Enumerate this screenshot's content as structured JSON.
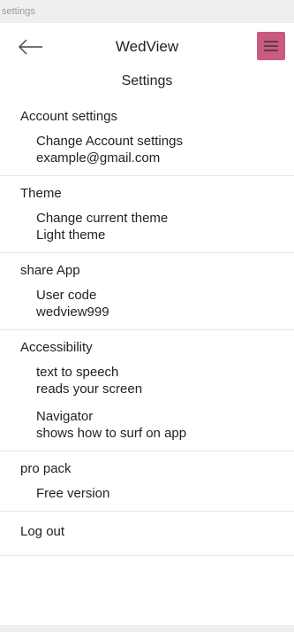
{
  "statusbar": {
    "text": "settings"
  },
  "appbar": {
    "title": "WedView",
    "back_icon": "arrow-left-icon",
    "menu_icon": "hamburger-menu-icon",
    "accent": "#c95a80"
  },
  "page": {
    "title": "Settings"
  },
  "sections": [
    {
      "title": "Account settings",
      "items": [
        {
          "label": "Change Account settings",
          "value": "example@gmail.com"
        }
      ]
    },
    {
      "title": "Theme",
      "items": [
        {
          "label": "Change current theme",
          "value": "Light theme"
        }
      ]
    },
    {
      "title": "share App",
      "items": [
        {
          "label": "User code",
          "value": "wedview999"
        }
      ]
    },
    {
      "title": "Accessibility",
      "items": [
        {
          "label": "text to speech",
          "value": "reads your screen"
        },
        {
          "label": "Navigator",
          "value": "shows how to surf on app"
        }
      ]
    },
    {
      "title": "pro pack",
      "items": [
        {
          "label": "Free version"
        }
      ]
    }
  ],
  "logout": {
    "label": "Log out"
  }
}
